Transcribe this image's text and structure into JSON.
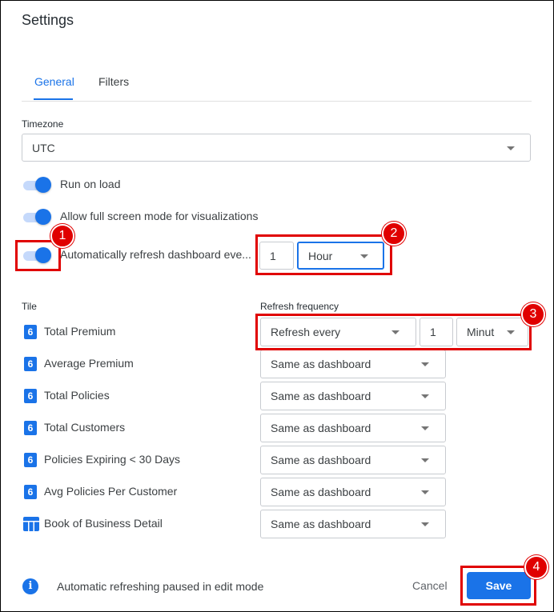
{
  "dialog": {
    "title": "Settings"
  },
  "tabs": [
    {
      "label": "General",
      "active": true
    },
    {
      "label": "Filters",
      "active": false
    }
  ],
  "timezone": {
    "label": "Timezone",
    "value": "UTC"
  },
  "toggles": [
    {
      "label": "Run on load",
      "on": true
    },
    {
      "label": "Allow full screen mode for visualizations",
      "on": true
    },
    {
      "label": "Automatically refresh dashboard eve...",
      "on": true
    }
  ],
  "auto_refresh": {
    "amount": "1",
    "unit": "Hour"
  },
  "tiles_table": {
    "col_tile": "Tile",
    "col_refresh": "Refresh frequency",
    "rows": [
      {
        "name": "Total Premium",
        "icon": "single-value-icon",
        "icon_glyph": "6",
        "frequency": "Refresh every",
        "amount": "1",
        "unit": "Minut"
      },
      {
        "name": "Average Premium",
        "icon": "single-value-icon",
        "icon_glyph": "6",
        "frequency": "Same as dashboard"
      },
      {
        "name": "Total Policies",
        "icon": "single-value-icon",
        "icon_glyph": "6",
        "frequency": "Same as dashboard"
      },
      {
        "name": "Total Customers",
        "icon": "single-value-icon",
        "icon_glyph": "6",
        "frequency": "Same as dashboard"
      },
      {
        "name": "Policies Expiring < 30 Days",
        "icon": "single-value-icon",
        "icon_glyph": "6",
        "frequency": "Same as dashboard"
      },
      {
        "name": "Avg Policies Per Customer",
        "icon": "single-value-icon",
        "icon_glyph": "6",
        "frequency": "Same as dashboard"
      },
      {
        "name": "Book of Business Detail",
        "icon": "table-icon",
        "frequency": "Same as dashboard"
      }
    ]
  },
  "footer": {
    "info_text": "Automatic refreshing paused in edit mode",
    "info_glyph": "i",
    "cancel_label": "Cancel",
    "save_label": "Save"
  },
  "annotations": [
    "1",
    "2",
    "3",
    "4"
  ],
  "colors": {
    "accent": "#1a73e8",
    "annotation": "#e00000"
  }
}
